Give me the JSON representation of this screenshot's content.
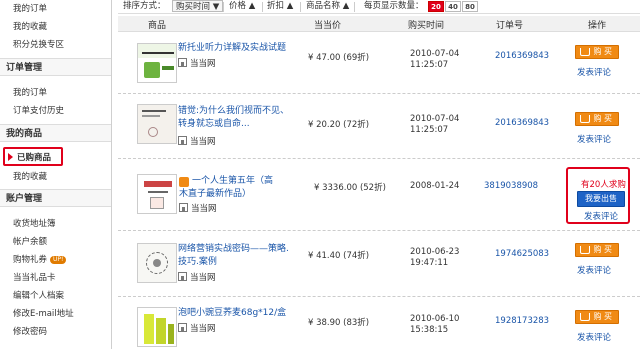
{
  "sidebar": {
    "items_top": [
      "我的订单",
      "我的收藏",
      "积分兑换专区"
    ],
    "section_order": "订单管理",
    "order_items": [
      "我的订单",
      "订单支付历史"
    ],
    "section_goods": "我的商品",
    "goods_active": "已购商品",
    "goods_items": [
      "我的收藏"
    ],
    "section_account": "账户管理",
    "account_items": [
      "收货地址簿",
      "帐户余额",
      "购物礼券",
      "当当礼品卡",
      "编辑个人档案",
      "修改E-mail地址",
      "修改密码"
    ],
    "coupon_badge": "UP!"
  },
  "sortbar": {
    "label": "排序方式：",
    "options": [
      "购买时间",
      "价格",
      "折扣",
      "商品名称"
    ],
    "per_page_label": "每页显示数量：",
    "per_page": [
      "20",
      "40",
      "80"
    ],
    "per_page_selected": "20"
  },
  "table": {
    "headers": [
      "商品",
      "当当价",
      "购买时间",
      "订单号",
      "操作"
    ],
    "rows": [
      {
        "title_lines": [
          "新托业听力详解及实战试题"
        ],
        "shop": "当当网",
        "price": "¥ 47.00 (69折)",
        "date": "2010-07-04",
        "time": "11:25:07",
        "order_no": "2016369843",
        "buy_label": "购 买",
        "review_label": "发表评论"
      },
      {
        "title_lines": [
          "错觉:为什么我们视而不见、",
          "转身就忘或自命..."
        ],
        "shop": "当当网",
        "price": "¥ 20.20 (72折)",
        "date": "2010-07-04",
        "time": "11:25:07",
        "order_no": "2016369843",
        "buy_label": "购 买",
        "review_label": "发表评论"
      },
      {
        "title_lines": [
          "一个人生第五年（高",
          "木直子最新作品）"
        ],
        "shop": "当当网",
        "price": "¥ 3336.00 (52折)",
        "date": "2008-01-24",
        "time": "",
        "order_no": "3819038908",
        "demand": "有20人求购",
        "sell_label": "我要出售",
        "review_label": "发表评论"
      },
      {
        "title_lines": [
          "网络营销实战密码——策略.",
          "技巧.案例"
        ],
        "shop": "当当网",
        "price": "¥ 41.40 (74折)",
        "date": "2010-06-23",
        "time": "19:47:11",
        "order_no": "1974625083",
        "buy_label": "购 买",
        "review_label": "发表评论"
      },
      {
        "title_lines": [
          "泡吧小豌豆荞麦68g*12/盒"
        ],
        "shop": "当当网",
        "price": "¥ 38.90 (83折)",
        "date": "2010-06-10",
        "time": "15:38:15",
        "order_no": "1928173283",
        "buy_label": "购 买",
        "review_label": "发表评论"
      }
    ]
  },
  "colors": {
    "accent_red": "#e0001b",
    "buy_orange": "#f08a14",
    "link_blue": "#1a55a8",
    "sell_blue": "#1e63c6"
  }
}
